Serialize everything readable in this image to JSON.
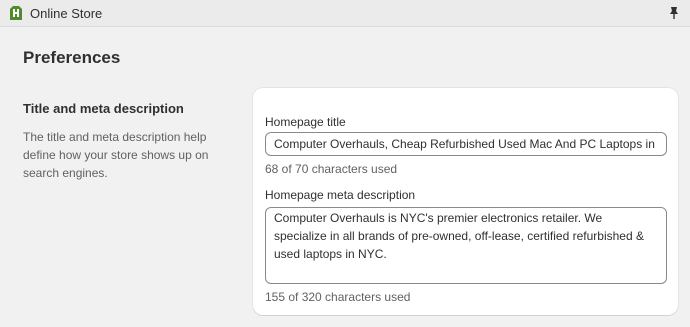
{
  "topbar": {
    "app_name": "Online Store",
    "app_icon": "shopify-bag-icon",
    "pin_icon": "pin-icon"
  },
  "page": {
    "title": "Preferences"
  },
  "section": {
    "heading": "Title and meta description",
    "description": "The title and meta description help define how your store shows up on search engines."
  },
  "form": {
    "homepage_title_label": "Homepage title",
    "homepage_title_value": "Computer Overhauls, Cheap Refurbished Used Mac And PC Laptops in NYC",
    "homepage_title_hint": "68 of 70 characters used",
    "meta_description_label": "Homepage meta description",
    "meta_description_value": "Computer Overhauls is NYC's premier electronics retailer. We specialize in all brands of pre-owned, off-lease, certified refurbished & used laptops in NYC.",
    "meta_description_hint": "155 of 320 characters used"
  },
  "colors": {
    "background": "#f1f1f1",
    "card": "#ffffff",
    "text": "#303030",
    "subdued_text": "#616161",
    "brand_green": "#5a8e3c"
  }
}
